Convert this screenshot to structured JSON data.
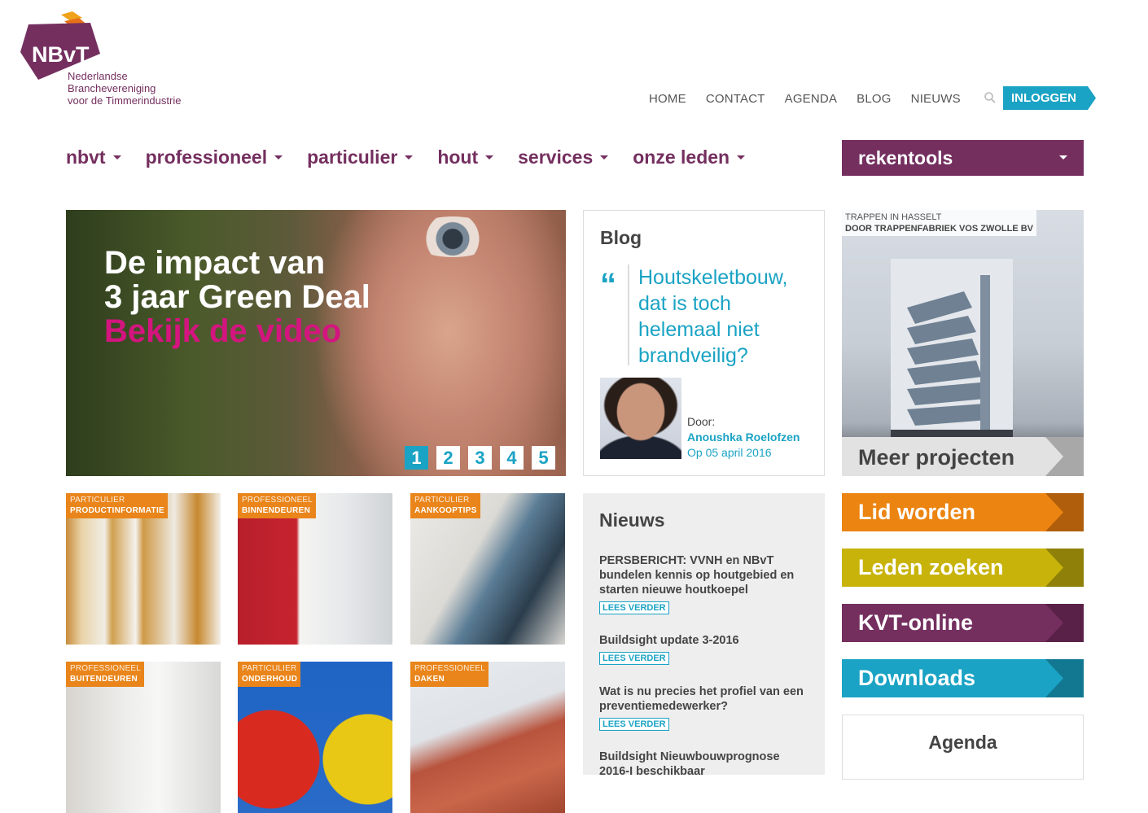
{
  "logo": {
    "abbr": "NBvT",
    "line1": "Nederlandse",
    "line2": "Branchevereniging",
    "line3": "voor de Timmerindustrie"
  },
  "topnav": {
    "items": [
      "HOME",
      "CONTACT",
      "AGENDA",
      "BLOG",
      "NIEUWS"
    ],
    "login": "INLOGGEN"
  },
  "mainmenu": {
    "items": [
      "nbvt",
      "professioneel",
      "particulier",
      "hout",
      "services",
      "onze leden"
    ],
    "rekentools": "rekentools"
  },
  "hero": {
    "line1": "De impact van",
    "line2": "3 jaar Green Deal",
    "line3": "Bekijk de video",
    "pages": [
      "1",
      "2",
      "3",
      "4",
      "5"
    ]
  },
  "blog": {
    "heading": "Blog",
    "quote": "Houtskeletbouw, dat is toch helemaal niet brandveilig?",
    "by": "Door:",
    "author": "Anoushka Roelofzen",
    "date": "Op 05 april 2016"
  },
  "project": {
    "line1": "TRAPPEN IN HASSELT",
    "line2": "DOOR TRAPPENFABRIEK VOS ZWOLLE BV",
    "more": "Meer projecten"
  },
  "tiles": [
    {
      "cat": "PARTICULIER",
      "title": "PRODUCTINFORMATIE"
    },
    {
      "cat": "PROFESSIONEEL",
      "title": "BINNENDEUREN"
    },
    {
      "cat": "PARTICULIER",
      "title": "AANKOOPTIPS"
    },
    {
      "cat": "PROFESSIONEEL",
      "title": "BUITENDEUREN"
    },
    {
      "cat": "PARTICULIER",
      "title": "ONDERHOUD"
    },
    {
      "cat": "PROFESSIONEEL",
      "title": "DAKEN"
    }
  ],
  "news": {
    "heading": "Nieuws",
    "more_label": "LEES VERDER",
    "items": [
      {
        "title": "PERSBERICHT: VVNH en NBvT bundelen kennis op houtgebied en starten nieuwe houtkoepel"
      },
      {
        "title": "Buildsight update 3-2016"
      },
      {
        "title": "Wat is nu precies het profiel van een preventiemedewerker?"
      },
      {
        "title": "Buildsight Nieuwbouwprognose 2016-I beschikbaar"
      }
    ]
  },
  "cta": {
    "lid": "Lid worden",
    "leden": "Leden zoeken",
    "kvt": "KVT-online",
    "downloads": "Downloads",
    "agenda": "Agenda"
  },
  "colors": {
    "purple": "#742f5f",
    "orange": "#ec8411",
    "yellow": "#c8b30a",
    "teal": "#1aa3c4",
    "pink": "#d4157f"
  }
}
